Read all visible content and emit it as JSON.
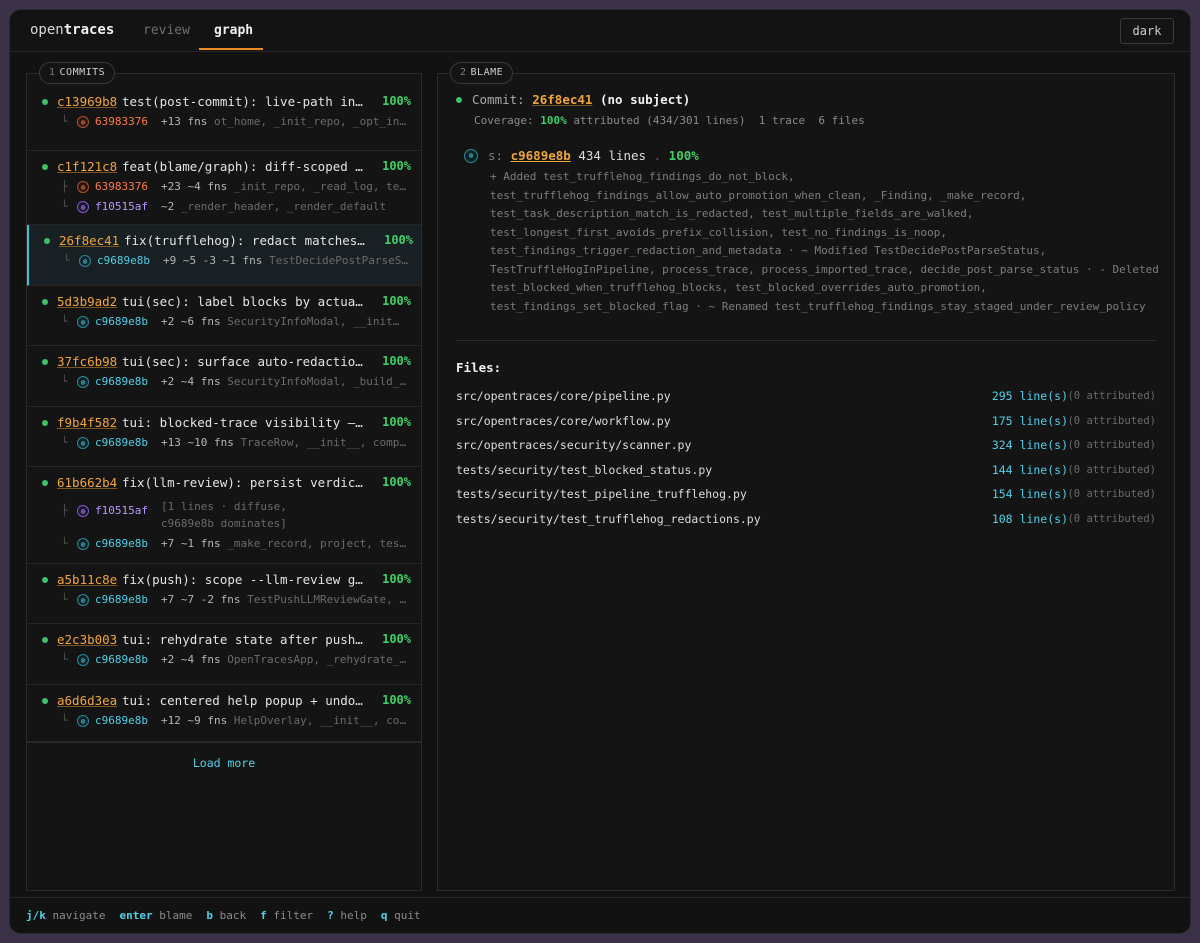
{
  "header": {
    "brand_pre": "open",
    "brand_bold": "traces",
    "tabs": [
      {
        "label": "review"
      },
      {
        "label": "graph"
      }
    ],
    "active_tab": "graph",
    "theme_button": "dark"
  },
  "commits_panel": {
    "number": "1",
    "title": "COMMITS",
    "load_more": "Load more",
    "commits": [
      {
        "hash": "c13969b8",
        "subject": "test(post-commit): live-path inte…",
        "pct": "100%",
        "traces": [
          {
            "branch": "└",
            "color": "orange",
            "id": "63983376",
            "stats": "+13 fns",
            "fns": "ot_home, _init_repo, _opt_in…"
          }
        ]
      },
      {
        "hash": "c1f121c8",
        "subject": "feat(blame/graph): diff-scoped co…",
        "pct": "100%",
        "traces": [
          {
            "branch": "├",
            "color": "orange",
            "id": "63983376",
            "stats": "+23 ~4 fns",
            "fns": "_init_repo, _read_log, te…"
          },
          {
            "branch": "└",
            "color": "purple",
            "id": "f10515af",
            "stats": "~2",
            "fns": "_render_header, _render_default"
          }
        ]
      },
      {
        "hash": "26f8ec41",
        "subject": "fix(trufflehog): redact matches i…",
        "pct": "100%",
        "selected": true,
        "traces": [
          {
            "branch": "└",
            "color": "cyan",
            "id": "c9689e8b",
            "stats": "+9 ~5 -3 ~1 fns",
            "fns": "TestDecidePostParseS…"
          }
        ]
      },
      {
        "hash": "5d3b9ad2",
        "subject": "tui(sec): label blocks by actual …",
        "pct": "100%",
        "traces": [
          {
            "branch": "└",
            "color": "cyan",
            "id": "c9689e8b",
            "stats": "+2 ~6 fns",
            "fns": "SecurityInfoModal, __init…"
          }
        ]
      },
      {
        "hash": "37fc6b98",
        "subject": "tui(sec): surface auto-redactions…",
        "pct": "100%",
        "traces": [
          {
            "branch": "└",
            "color": "cyan",
            "id": "c9689e8b",
            "stats": "+2 ~4 fns",
            "fns": "SecurityInfoModal, _build_…"
          }
        ]
      },
      {
        "hash": "f9b4f582",
        "subject": "tui: blocked-trace visibility — r…",
        "pct": "100%",
        "traces": [
          {
            "branch": "└",
            "color": "cyan",
            "id": "c9689e8b",
            "stats": "+13 ~10 fns",
            "fns": "TraceRow, __init__, comp…"
          }
        ]
      },
      {
        "hash": "61b662b4",
        "subject": "fix(llm-review): persist verdicts…",
        "pct": "100%",
        "traces": [
          {
            "branch": "├",
            "color": "purple",
            "id": "f10515af",
            "note": "[1 lines · diffuse, c9689e8b dominates]"
          },
          {
            "branch": "└",
            "color": "cyan",
            "id": "c9689e8b",
            "stats": "+7 ~1 fns",
            "fns": "_make_record, project, tes…"
          }
        ]
      },
      {
        "hash": "a5b11c8e",
        "subject": "fix(push): scope --llm-review gat…",
        "pct": "100%",
        "traces": [
          {
            "branch": "└",
            "color": "cyan",
            "id": "c9689e8b",
            "stats": "+7 ~7 -2 fns",
            "fns": "TestPushLLMReviewGate, …"
          }
        ]
      },
      {
        "hash": "e2c3b003",
        "subject": "tui: rehydrate state after push s…",
        "pct": "100%",
        "traces": [
          {
            "branch": "└",
            "color": "cyan",
            "id": "c9689e8b",
            "stats": "+2 ~4 fns",
            "fns": "OpenTracesApp, _rehydrate_…"
          }
        ]
      },
      {
        "hash": "a6d6d3ea",
        "subject": "tui: centered help popup + undo s…",
        "pct": "100%",
        "traces": [
          {
            "branch": "└",
            "color": "cyan",
            "id": "c9689e8b",
            "stats": "+12 ~9 fns",
            "fns": "HelpOverlay, __init__, co…"
          }
        ]
      }
    ]
  },
  "blame_panel": {
    "number": "2",
    "title": "BLAME",
    "commit_label": "Commit:",
    "commit_hash": "26f8ec41",
    "commit_subject": "(no subject)",
    "coverage_label": "Coverage:",
    "coverage_pct": "100%",
    "coverage_rest": " attributed (434/301 lines)  1 trace  6 files",
    "trace": {
      "prefix": "s:",
      "id": "c9689e8b",
      "lines": "434 lines",
      "sep": ".",
      "pct": "100%",
      "summary": [
        "+ Added test_trufflehog_findings_do_not_block,",
        "test_trufflehog_findings_allow_auto_promotion_when_clean, _Finding, _make_record,",
        "test_task_description_match_is_redacted, test_multiple_fields_are_walked,",
        "test_longest_first_avoids_prefix_collision, test_no_findings_is_noop,",
        "test_findings_trigger_redaction_and_metadata · ~ Modified TestDecidePostParseStatus,",
        "TestTruffleHogInPipeline, process_trace, process_imported_trace, decide_post_parse_status · - Deleted",
        "test_blocked_when_trufflehog_blocks, test_blocked_overrides_auto_promotion,",
        "test_findings_set_blocked_flag · ~ Renamed test_trufflehog_findings_stay_staged_under_review_policy"
      ]
    },
    "files_title": "Files:",
    "files": [
      {
        "path": "src/opentraces/core/pipeline.py",
        "lines": "295 line(s)",
        "attributed": "(0 attributed)"
      },
      {
        "path": "src/opentraces/core/workflow.py",
        "lines": "175 line(s)",
        "attributed": "(0 attributed)"
      },
      {
        "path": "src/opentraces/security/scanner.py",
        "lines": "324 line(s)",
        "attributed": "(0 attributed)"
      },
      {
        "path": "tests/security/test_blocked_status.py",
        "lines": "144 line(s)",
        "attributed": "(0 attributed)"
      },
      {
        "path": "tests/security/test_pipeline_trufflehog.py",
        "lines": "154 line(s)",
        "attributed": "(0 attributed)"
      },
      {
        "path": "tests/security/test_trufflehog_redactions.py",
        "lines": "108 line(s)",
        "attributed": "(0 attributed)"
      }
    ]
  },
  "footer": {
    "keys": [
      {
        "key": "j/k",
        "desc": "navigate"
      },
      {
        "key": "enter",
        "desc": "blame"
      },
      {
        "key": "b",
        "desc": "back"
      },
      {
        "key": "f",
        "desc": "filter"
      },
      {
        "key": "?",
        "desc": "help"
      },
      {
        "key": "q",
        "desc": "quit"
      }
    ]
  },
  "colors": {
    "accent": "#f08a24",
    "hash": "#f0a53a",
    "ok": "#3fcf6a",
    "link": "#4ed0e8",
    "purple": "#b896ff",
    "orange": "#ff7a45"
  }
}
